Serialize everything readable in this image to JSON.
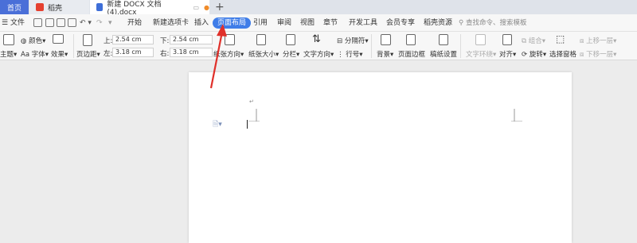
{
  "tabs": {
    "home": "首页",
    "daoke": "稻壳",
    "doc": "新建 DOCX 文档 (4).docx",
    "plus": "+"
  },
  "menu": {
    "file": "文件",
    "items": [
      "开始",
      "新建选项卡",
      "插入",
      "页面布局",
      "引用",
      "审阅",
      "视图",
      "章节",
      "开发工具",
      "会员专享",
      "稻壳资源"
    ],
    "search_placeholder": "查找命令、搜索模板"
  },
  "ribbon": {
    "theme": "主题",
    "color": "颜色",
    "font": "字体",
    "effect": "效果",
    "margins": "页边距",
    "top_label": "上:",
    "top_value": "2.54 cm",
    "bottom_label": "下:",
    "bottom_value": "2.54 cm",
    "left_label": "左:",
    "left_value": "3.18 cm",
    "right_label": "右:",
    "right_value": "3.18 cm",
    "orientation": "纸张方向",
    "size": "纸张大小",
    "columns": "分栏",
    "text_direction": "文字方向",
    "separator": "分隔符",
    "line_numbers": "行号",
    "background": "背景",
    "page_border": "页面边框",
    "grid_paper": "稿纸设置",
    "wrap": "文字环绕",
    "align": "对齐",
    "group": "组合",
    "rotate": "旋转",
    "selection_pane": "选择窗格",
    "bring_forward": "上移一层",
    "send_backward": "下移一层"
  },
  "colors": {
    "accent": "#3f7de8",
    "home_tab": "#4a6fd8",
    "arrow": "#e0302a"
  }
}
